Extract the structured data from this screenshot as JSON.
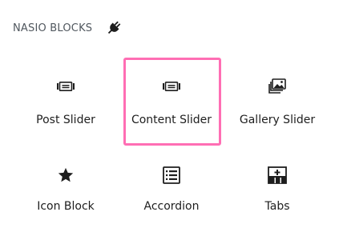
{
  "panel": {
    "title": "NASIO BLOCKS",
    "title_icon": "plug-icon"
  },
  "blocks": [
    {
      "label": "Post Slider",
      "icon": "slider-icon"
    },
    {
      "label": "Content Slider",
      "icon": "slider-icon",
      "selected": true
    },
    {
      "label": "Gallery Slider",
      "icon": "gallery-icon"
    },
    {
      "label": "Icon Block",
      "icon": "star-icon"
    },
    {
      "label": "Accordion",
      "icon": "list-icon"
    },
    {
      "label": "Tabs",
      "icon": "tabs-icon"
    }
  ],
  "colors": {
    "selection_border": "#ff6eb4",
    "text": "#1e1e1e",
    "header_text": "#50575e"
  }
}
